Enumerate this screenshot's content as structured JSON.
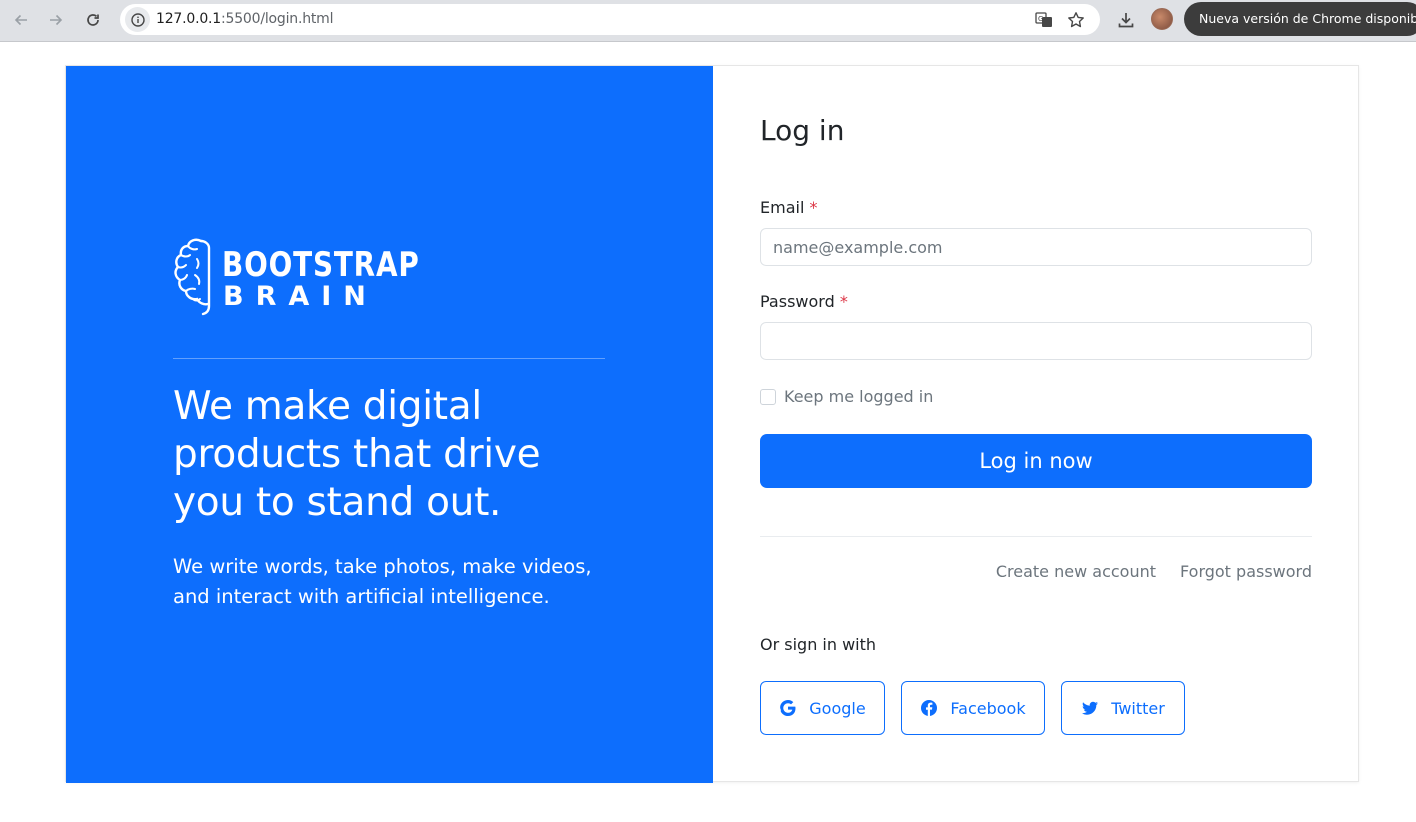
{
  "browser": {
    "url_host": "127.0.0.1",
    "url_path": ":5500/login.html",
    "update_notice": "Nueva versión de Chrome disponible",
    "icons": [
      "back-icon",
      "forward-icon",
      "reload-icon",
      "site-info-icon",
      "translate-icon",
      "bookmark-star-icon",
      "download-icon"
    ]
  },
  "hero": {
    "logo_line1": "BOOTSTRAP",
    "logo_line2": "BRAIN",
    "headline": "We make digital products that drive you to stand out.",
    "subline": "We write words, take photos, make videos, and interact with artificial intelligence."
  },
  "form": {
    "title": "Log in",
    "email_label": "Email",
    "email_placeholder": "name@example.com",
    "password_label": "Password",
    "required_marker": "*",
    "remember_label": "Keep me logged in",
    "submit_label": "Log in now",
    "create_account": "Create new account",
    "forgot_password": "Forgot password",
    "or_sign_in": "Or sign in with",
    "social": [
      {
        "label": "Google",
        "icon": "google-icon"
      },
      {
        "label": "Facebook",
        "icon": "facebook-icon"
      },
      {
        "label": "Twitter",
        "icon": "twitter-icon"
      }
    ]
  },
  "colors": {
    "primary": "#0d6efd",
    "required": "#dc3545",
    "muted": "#6c757d"
  }
}
